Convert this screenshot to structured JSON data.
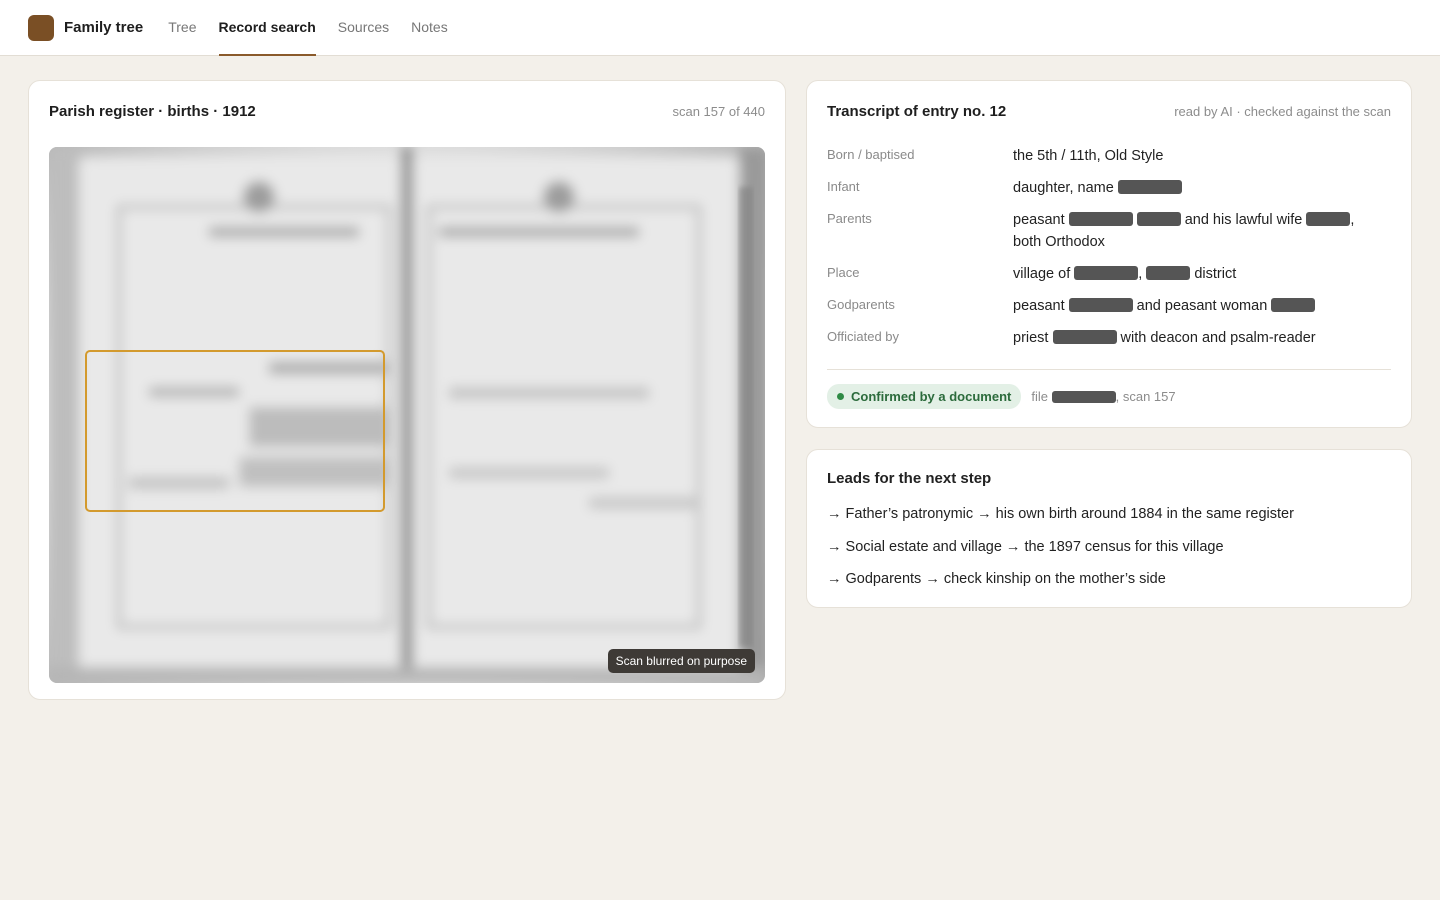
{
  "app": {
    "brand": "Family tree"
  },
  "nav": [
    {
      "label": "Tree",
      "active": false
    },
    {
      "label": "Record search",
      "active": true
    },
    {
      "label": "Sources",
      "active": false
    },
    {
      "label": "Notes",
      "active": false
    }
  ],
  "scan_panel": {
    "title": "Parish register · births · 1912",
    "counter": "scan 157 of 440",
    "badge": "Scan blurred on purpose"
  },
  "transcript": {
    "title": "Transcript of entry no. 12",
    "meta": "read by AI · checked against the scan",
    "fields": [
      {
        "label": "Born / baptised",
        "value_a": "the 5th / 11th, Old Style"
      },
      {
        "label": "Infant",
        "value_a": "daughter, name"
      },
      {
        "label": "Parents",
        "value_a": "peasant",
        "value_b": "and his lawful wife",
        "value_c": ",",
        "value_d": "both Orthodox"
      },
      {
        "label": "Place",
        "value_a": "village of",
        "value_b": ",",
        "value_c": "district"
      },
      {
        "label": "Godparents",
        "value_a": "peasant",
        "value_b": "and peasant woman"
      },
      {
        "label": "Officiated by",
        "value_a": "priest",
        "value_b": "with deacon and psalm-reader"
      }
    ],
    "status": "Confirmed by a document",
    "file_prefix": "file",
    "file_suffix": ", scan 157",
    "status_color": "#2f8a45"
  },
  "leads": {
    "title": "Leads for the next step",
    "items": [
      "→ Father’s patronymic → his own birth around 1884 in the same register",
      "→ Social estate and village → the 1897 census for this village",
      "→ Godparents → check kinship on the mother’s side"
    ]
  },
  "colors": {
    "accent": "#8a5a2b",
    "highlight": "#d39a2e",
    "logo": "#7a4f25"
  }
}
